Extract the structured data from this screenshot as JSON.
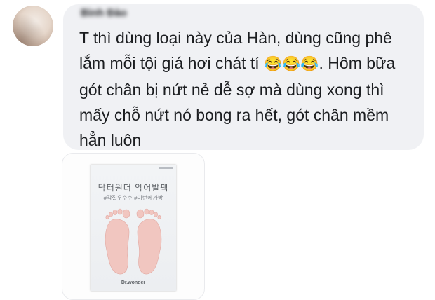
{
  "comment": {
    "author": "Bình Đào",
    "text": "T thì dùng loại này của Hàn, dùng cũng phê lắm mỗi tội giá hơi chát tí",
    "emojis": "😂😂😂",
    "text_after": ". Hôm bữa gót chân bị nứt nẻ dễ sợ mà dùng xong thì mấy chỗ nứt nó bong ra hết, gót chân mềm hẳn luôn"
  },
  "attachment": {
    "title": "닥터원더 악어발팩",
    "subtitle": "#각질우수수 #이번에가방",
    "brand": "Dr.wonder",
    "icon": "foot-mask-image"
  },
  "colors": {
    "bubble": "#f0f1f4",
    "text": "#1c1e21",
    "feet": "#f1c6c0"
  }
}
